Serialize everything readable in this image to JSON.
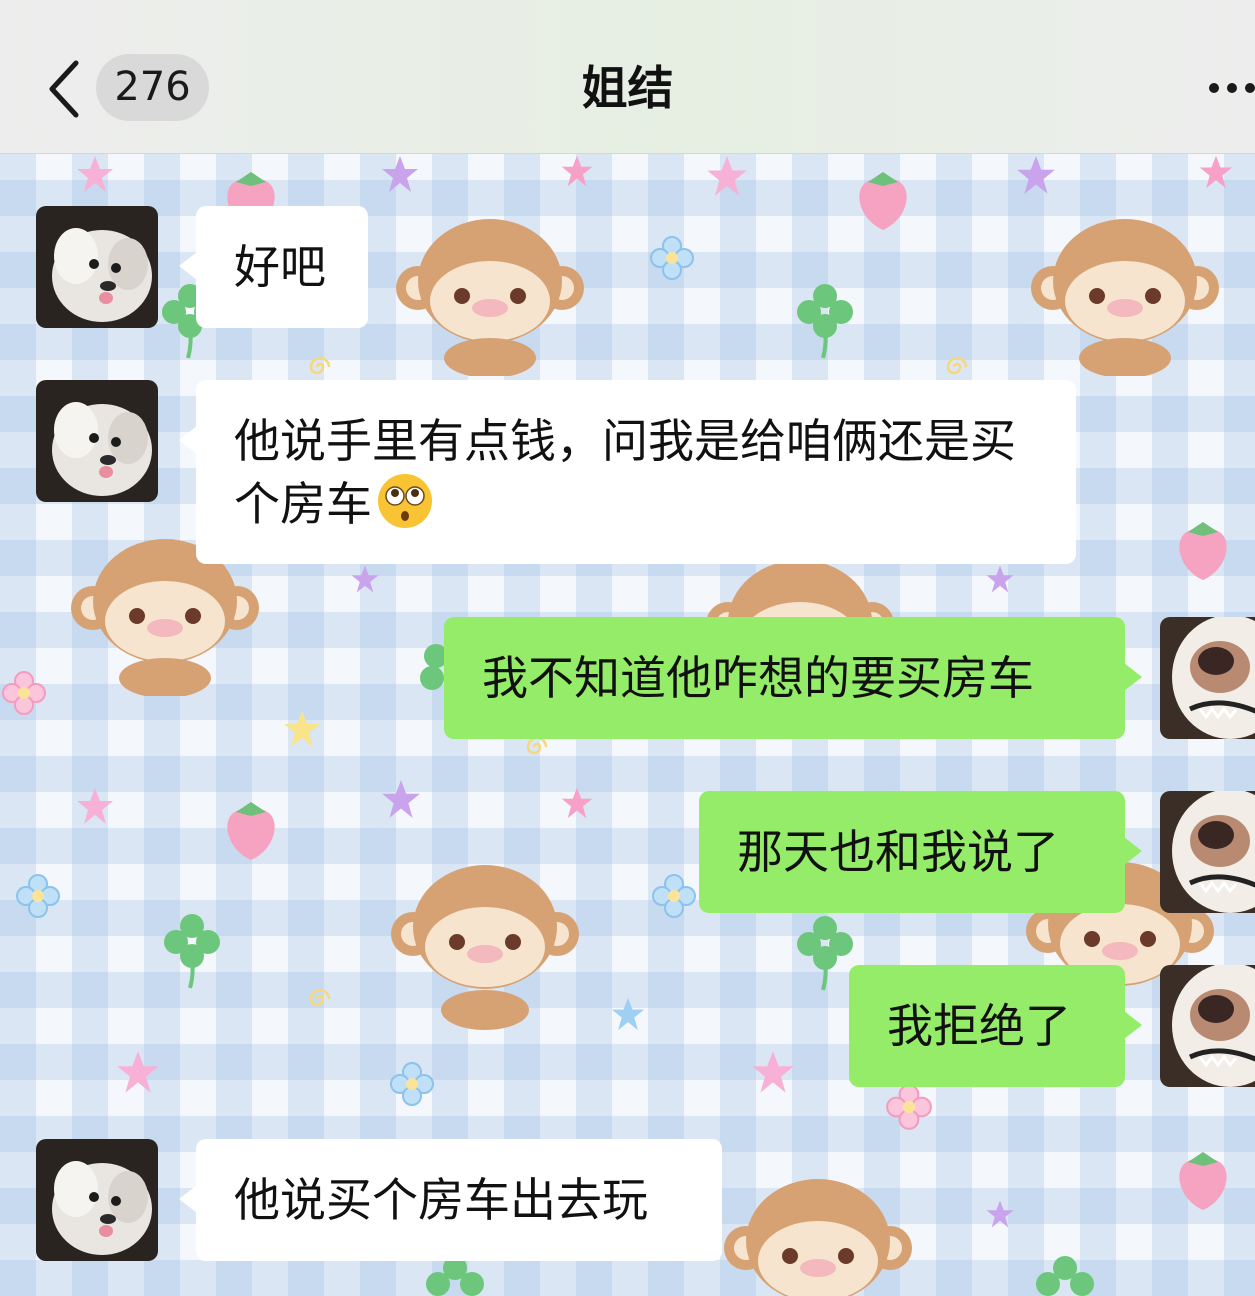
{
  "header": {
    "back_count": "276",
    "title": "姐结"
  },
  "messages": [
    {
      "side": "left",
      "sender": "other",
      "text": "好吧"
    },
    {
      "side": "left",
      "sender": "other",
      "text": "他说手里有点钱，问我是给咱俩还是买个房车",
      "emoji": "flushed-face"
    },
    {
      "side": "right",
      "sender": "me",
      "text": "我不知道他咋想的要买房车"
    },
    {
      "side": "right",
      "sender": "me",
      "text": "那天也和我说了"
    },
    {
      "side": "right",
      "sender": "me",
      "text": "我拒绝了"
    },
    {
      "side": "left",
      "sender": "other",
      "text": "他说买个房车出去玩"
    }
  ],
  "colors": {
    "outgoing_bubble": "#95ec69",
    "incoming_bubble": "#ffffff",
    "navbar": "#ededed"
  }
}
